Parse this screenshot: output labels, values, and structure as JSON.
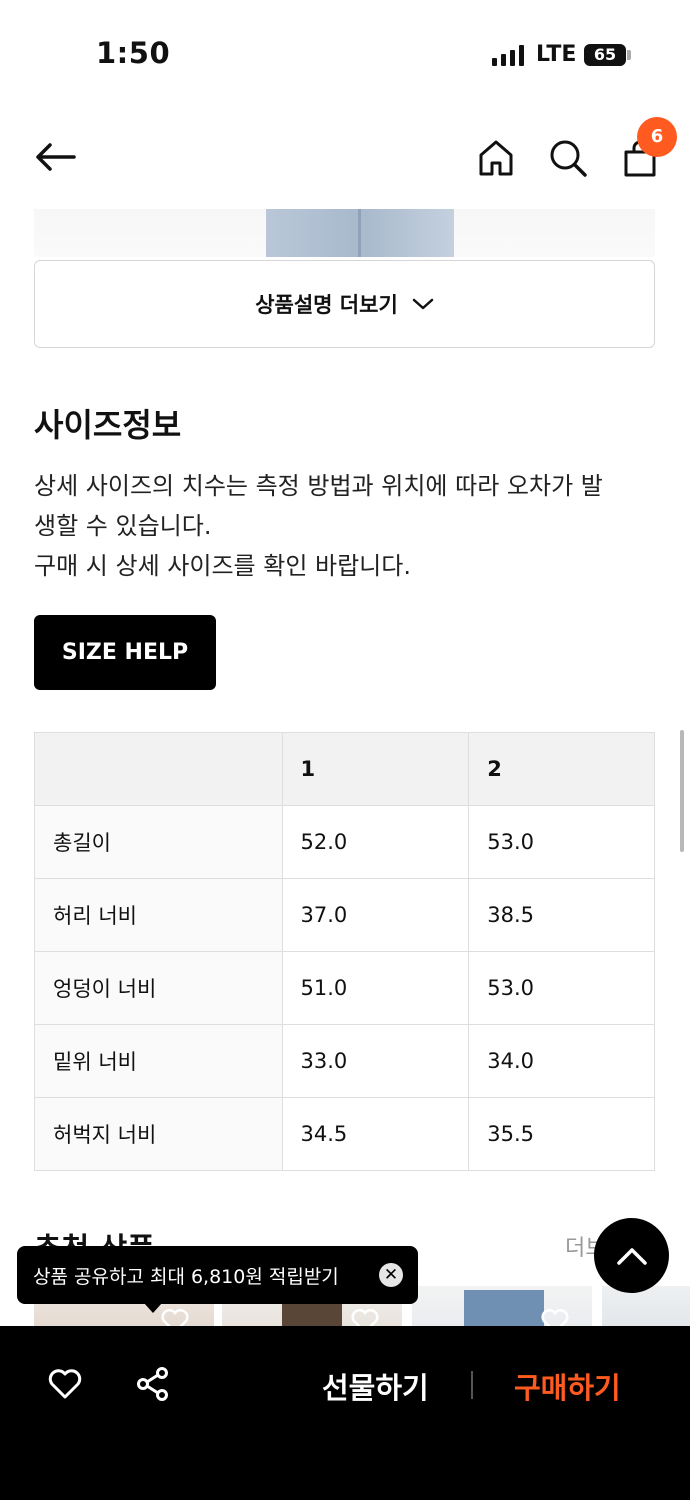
{
  "status_bar": {
    "time": "1:50",
    "network": "LTE",
    "battery": "65"
  },
  "header": {
    "cart_count": "6"
  },
  "product": {
    "more_description_label": "상품설명 더보기"
  },
  "size_info": {
    "title": "사이즈정보",
    "description_lines": [
      "상세 사이즈의 치수는 측정 방법과 위치에 따라 오차가 발",
      "생할 수 있습니다.",
      "구매 시 상세 사이즈를 확인 바랍니다."
    ],
    "size_help_label": "SIZE HELP",
    "table": {
      "headers": [
        "",
        "1",
        "2"
      ],
      "rows": [
        {
          "label": "총길이",
          "values": [
            "52.0",
            "53.0"
          ]
        },
        {
          "label": "허리 너비",
          "values": [
            "37.0",
            "38.5"
          ]
        },
        {
          "label": "엉덩이 너비",
          "values": [
            "51.0",
            "53.0"
          ]
        },
        {
          "label": "밑위 너비",
          "values": [
            "33.0",
            "34.0"
          ]
        },
        {
          "label": "허벅지 너비",
          "values": [
            "34.5",
            "35.5"
          ]
        }
      ]
    }
  },
  "recommended": {
    "title": "추천 상품",
    "more_label": "더보"
  },
  "toast": {
    "text": "상품 공유하고 최대 6,810원 적립받기"
  },
  "bottom_bar": {
    "gift_label": "선물하기",
    "buy_label": "구매하기"
  },
  "colors": {
    "accent": "#ff5a1f",
    "black": "#000000"
  }
}
